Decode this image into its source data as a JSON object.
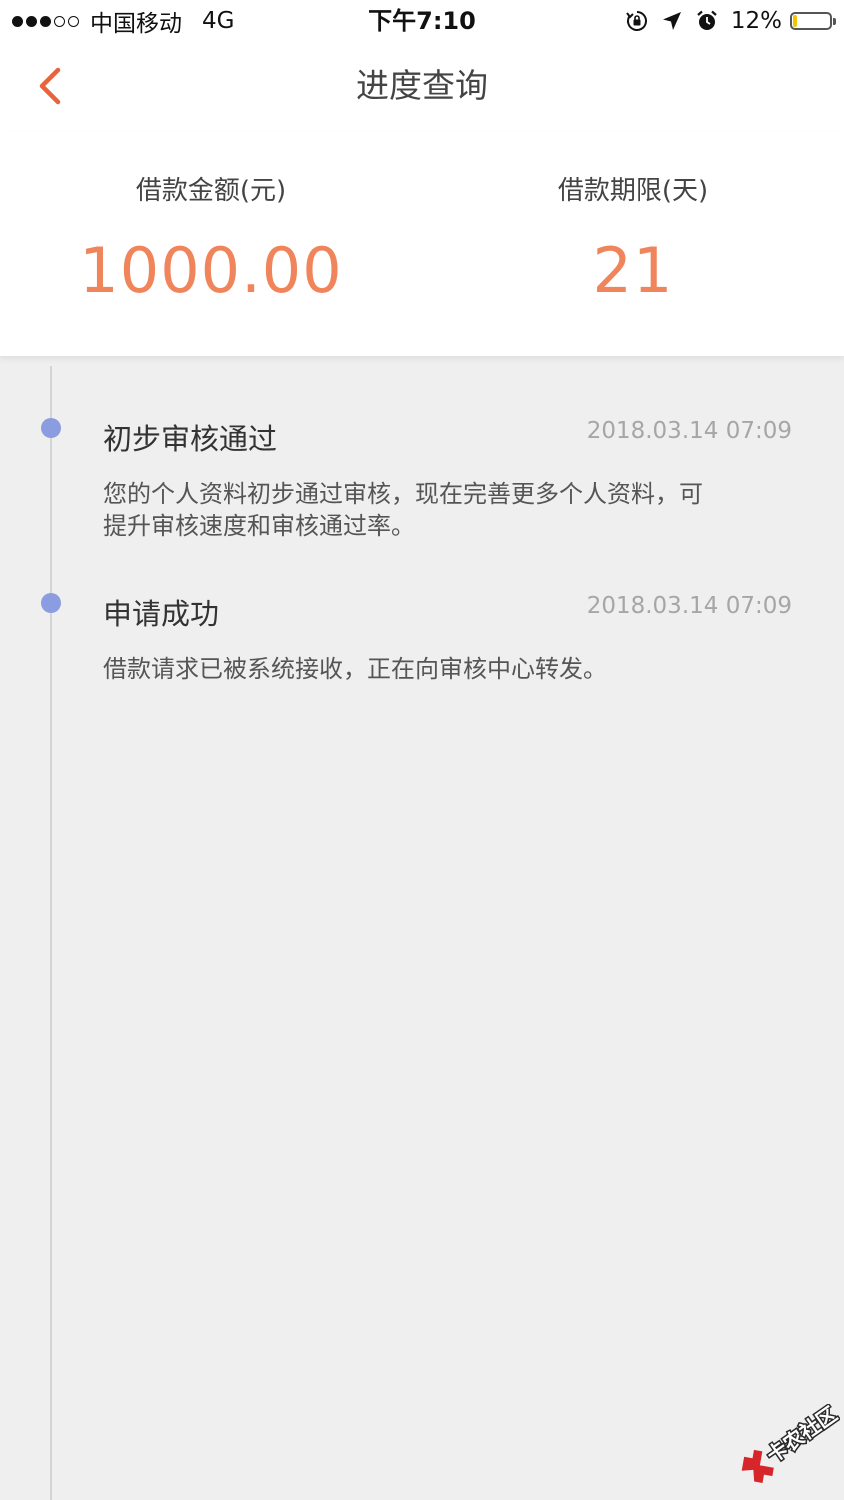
{
  "status_bar": {
    "carrier": "中国移动",
    "network": "4G",
    "time": "下午7:10",
    "battery_text": "12%",
    "battery_level": 0.12,
    "signal_bars_filled": 3,
    "signal_bars_total": 5,
    "icons": [
      "rotation-lock-icon",
      "location-arrow-icon",
      "alarm-icon",
      "battery-icon"
    ]
  },
  "nav": {
    "title": "进度查询",
    "back_icon": "chevron-left-icon"
  },
  "summary": {
    "amount_label": "借款金额(元)",
    "amount_value": "1000.00",
    "term_label": "借款期限(天)",
    "term_value": "21"
  },
  "timeline": [
    {
      "title": "初步审核通过",
      "time": "2018.03.14 07:09",
      "desc_line1": "您的个人资料初步通过审核，现在完善更多个人资料，可",
      "desc_line2": "提升审核速度和审核通过率。"
    },
    {
      "title": "申请成功",
      "time": "2018.03.14 07:09",
      "desc_line1": "借款请求已被系统接收，正在向审核中心转发。"
    }
  ],
  "watermark": {
    "text": "卡农社区"
  },
  "colors": {
    "accent": "#f0855b",
    "back_arrow": "#e8643c",
    "timeline_dot": "#8b9de0",
    "battery_fill": "#f5c400",
    "background": "#efefef"
  }
}
